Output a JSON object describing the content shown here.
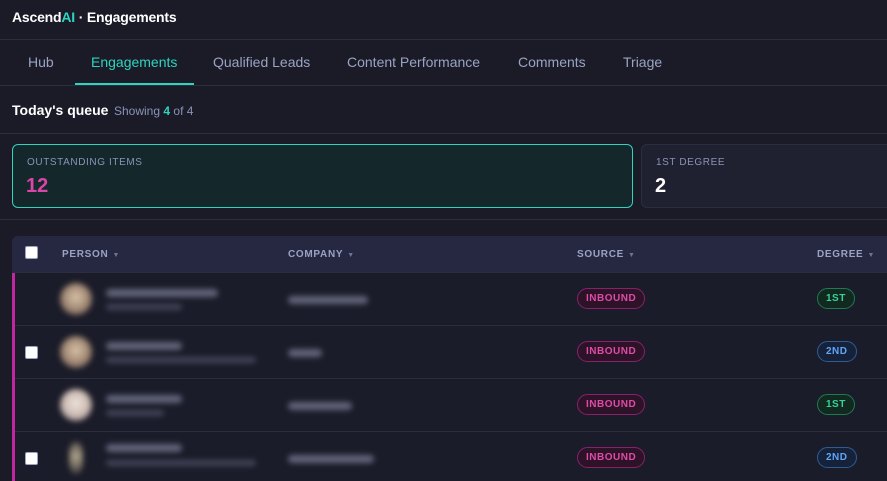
{
  "app": {
    "brand_prefix": "Ascend",
    "brand_ai": "AI",
    "page_title": "· Engagements"
  },
  "tabs": [
    {
      "label": "Hub"
    },
    {
      "label": "Engagements",
      "active": true
    },
    {
      "label": "Qualified Leads"
    },
    {
      "label": "Content Performance"
    },
    {
      "label": "Comments"
    },
    {
      "label": "Triage"
    }
  ],
  "queue": {
    "title": "Today's queue",
    "showing_prefix": "Showing",
    "showing_count": "4",
    "showing_of": "of 4"
  },
  "stats": [
    {
      "label": "OUTSTANDING ITEMS",
      "value": "12"
    },
    {
      "label": "1ST DEGREE",
      "value": "2"
    }
  ],
  "table": {
    "columns": [
      "PERSON",
      "COMPANY",
      "SOURCE",
      "DEGREE"
    ],
    "rows": [
      {
        "source": "INBOUND",
        "degree": "1ST",
        "degree_style": "deg1"
      },
      {
        "source": "INBOUND",
        "degree": "2ND",
        "degree_style": "deg2"
      },
      {
        "source": "INBOUND",
        "degree": "1ST",
        "degree_style": "deg1"
      },
      {
        "source": "INBOUND",
        "degree": "2ND",
        "degree_style": "deg2"
      }
    ]
  },
  "colors": {
    "accent": "#2dd4bf",
    "pink": "#d946a8",
    "background": "#1a1b26"
  }
}
